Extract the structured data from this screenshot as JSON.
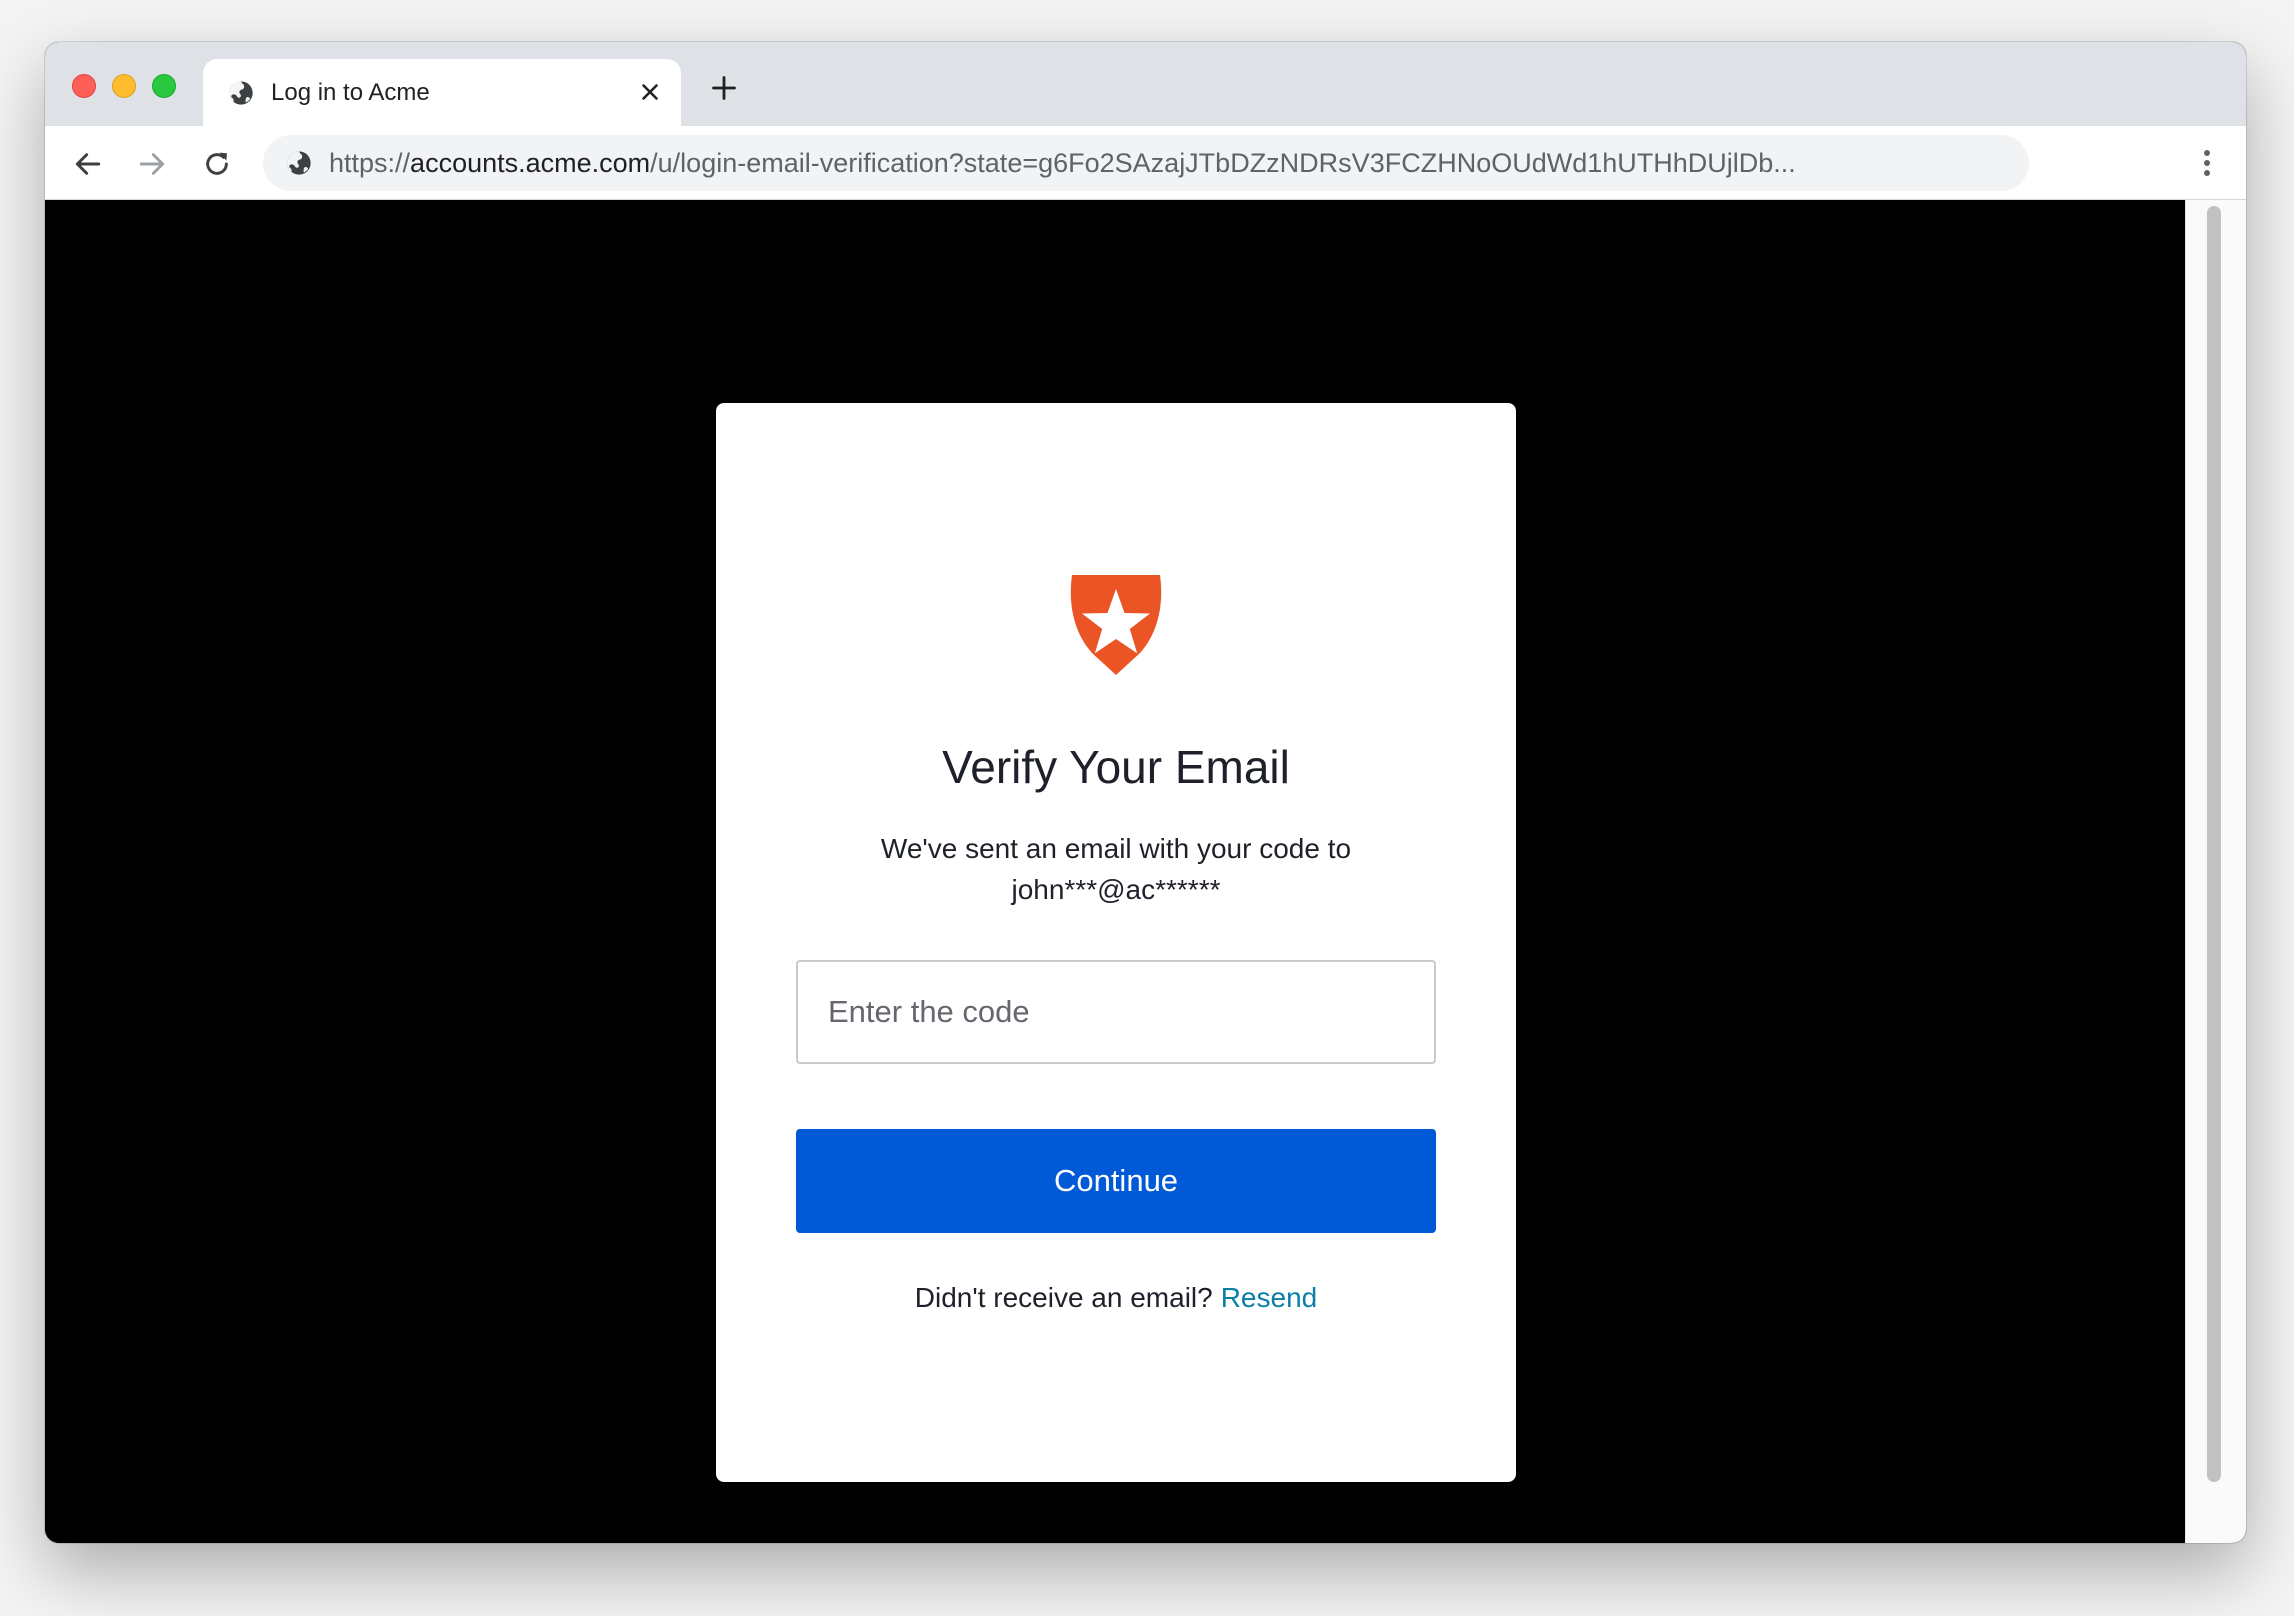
{
  "browser": {
    "tab": {
      "title": "Log in to Acme",
      "icon": "globe-icon"
    },
    "address": {
      "prefix": "https://",
      "host": "accounts.acme.com",
      "path": "/u/login-email-verification?state=g6Fo2SAzajJTbDZzNDRsV3FCZHNoOUdWd1hUTHhDUjlDb..."
    }
  },
  "verify": {
    "logo_icon": "shield-star-logo",
    "brand_color": "#eb5424",
    "title": "Verify Your Email",
    "description_line1": "We've sent an email with your code to",
    "description_line2": "john***@ac******",
    "code_placeholder": "Enter the code",
    "continue_label": "Continue",
    "continue_color": "#0059d6",
    "resend_prompt": "Didn't receive an email?",
    "resend_label": "Resend"
  }
}
